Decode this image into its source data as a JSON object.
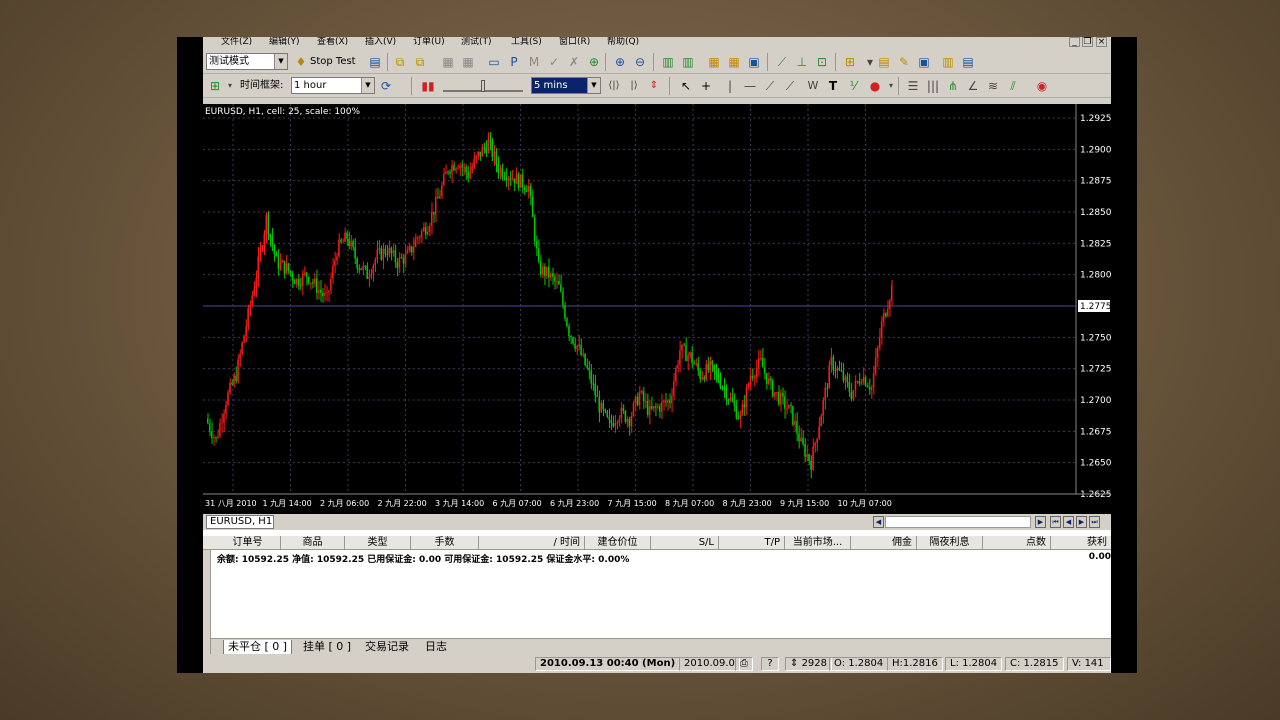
{
  "menu": [
    "文件(Z)",
    "编辑(Y)",
    "查看(X)",
    "插入(V)",
    "订单(U)",
    "测试(T)",
    "工具(S)",
    "窗口(R)",
    "帮助(Q)"
  ],
  "toolbar1": {
    "mode_value": "测试模式",
    "stop_test_label": "Stop Test"
  },
  "toolbar2": {
    "timeframe_label": "时间框架:",
    "timeframe_value": "1 hour",
    "speed_value": "5 mins"
  },
  "chart": {
    "title": "EURUSD, H1, cell: 25, scale: 100%",
    "current_price_label": "1.2775",
    "up_color": "#ff1a1a",
    "down_color": "#00cc00",
    "grid_color": "#3a3a5a"
  },
  "chart_data": {
    "type": "candlestick",
    "symbol": "EURUSD",
    "timeframe": "H1",
    "ylim": [
      1.2625,
      1.2925
    ],
    "y_ticks": [
      "1.2925",
      "1.2900",
      "1.2875",
      "1.2850",
      "1.2825",
      "1.2800",
      "1.2775",
      "1.2750",
      "1.2725",
      "1.2700",
      "1.2675",
      "1.2650",
      "1.2625"
    ],
    "x_ticks": [
      "31 八月 2010",
      "1 九月 14:00",
      "2 九月 06:00",
      "2 九月 22:00",
      "3 九月 14:00",
      "6 九月 07:00",
      "6 九月 23:00",
      "7 九月 15:00",
      "8 九月 07:00",
      "8 九月 23:00",
      "9 九月 15:00",
      "10 九月 07:00"
    ],
    "price_path": [
      1.2685,
      1.2668,
      1.27,
      1.272,
      1.276,
      1.28,
      1.2845,
      1.281,
      1.2805,
      1.2795,
      1.28,
      1.279,
      1.278,
      1.282,
      1.283,
      1.281,
      1.28,
      1.2815,
      1.282,
      1.281,
      1.2815,
      1.283,
      1.284,
      1.286,
      1.2885,
      1.289,
      1.288,
      1.2895,
      1.2905,
      1.2885,
      1.288,
      1.2875,
      1.287,
      1.2805,
      1.28,
      1.279,
      1.2755,
      1.274,
      1.272,
      1.2695,
      1.268,
      1.269,
      1.2685,
      1.2705,
      1.269,
      1.2695,
      1.27,
      1.274,
      1.2735,
      1.272,
      1.2725,
      1.2715,
      1.27,
      1.2685,
      1.272,
      1.273,
      1.271,
      1.27,
      1.269,
      1.2665,
      1.265,
      1.269,
      1.273,
      1.272,
      1.2705,
      1.272,
      1.271,
      1.276,
      1.279
    ],
    "current_price": 1.2775
  },
  "terminal": {
    "symbol_tab": "EURUSD, H1",
    "columns": [
      "订单号",
      "商品",
      "类型",
      "手数",
      "/ 时间",
      "建仓价位",
      "S/L",
      "T/P",
      "当前市场...",
      "佣金",
      "隔夜利息",
      "点数",
      "获利"
    ],
    "balance_text": "余额: 10592.25 净值: 10592.25 已用保证金: 0.00 可用保证金: 10592.25 保证金水平: 0.00%",
    "profit_total": "0.00",
    "tabs": [
      "未平仓 [ 0 ]",
      "挂单 [ 0 ]",
      "交易记录",
      "日志"
    ]
  },
  "status_bar": {
    "datetime": "2010.09.13 00:40 (Mon)",
    "date_short": "2010.09.0",
    "bars": "2928",
    "open": "O: 1.2804",
    "high": "H:1.2816",
    "low": "L: 1.2804",
    "close": "C: 1.2815",
    "volume": "V: 141"
  }
}
